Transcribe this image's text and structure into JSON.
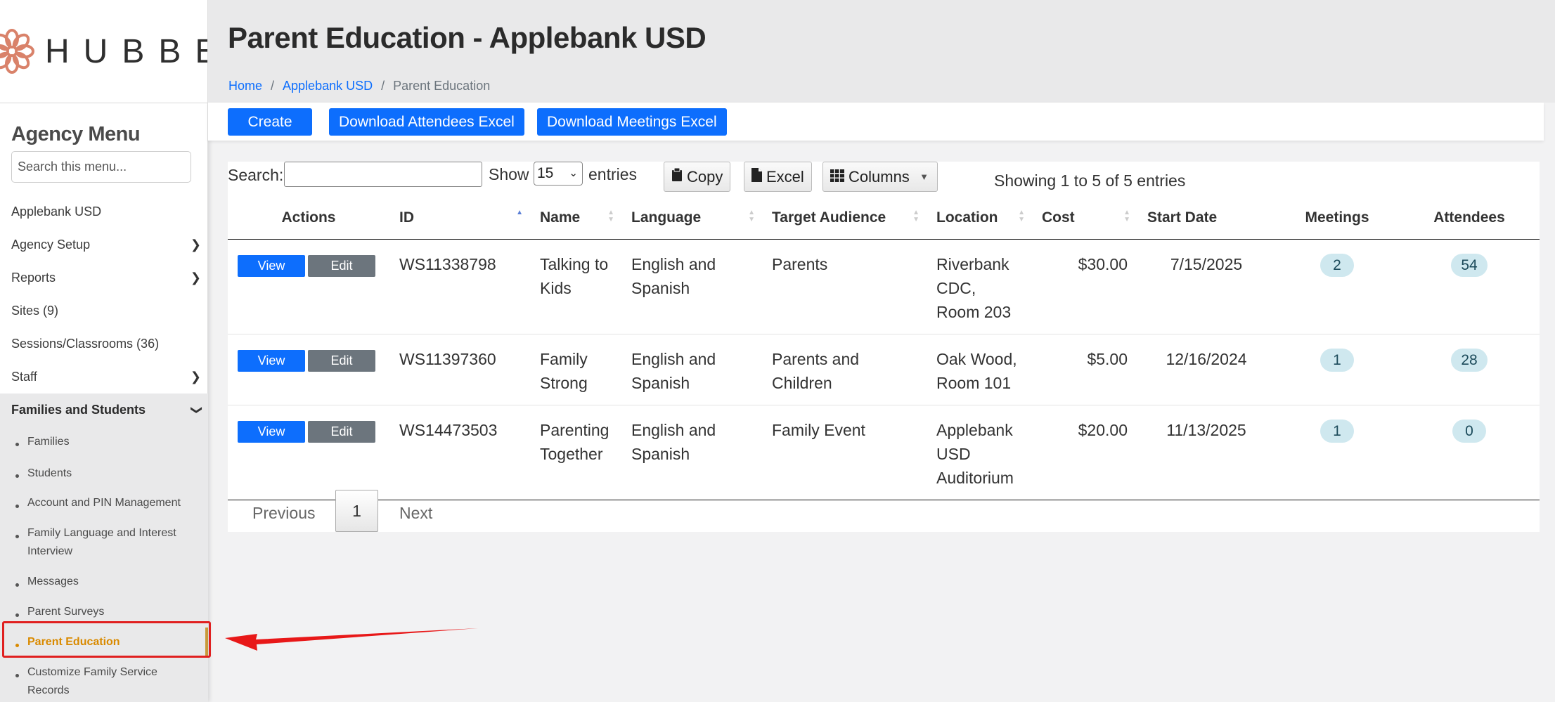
{
  "brand": {
    "name": "HUBBE"
  },
  "sidebar": {
    "title": "Agency Menu",
    "search_placeholder": "Search this menu...",
    "items": [
      {
        "label": "Applebank USD",
        "has_chevron": false
      },
      {
        "label": "Agency Setup",
        "has_chevron": true
      },
      {
        "label": "Reports",
        "has_chevron": true
      },
      {
        "label": "Sites (9)",
        "has_chevron": false
      },
      {
        "label": "Sessions/Classrooms (36)",
        "has_chevron": false
      },
      {
        "label": "Staff",
        "has_chevron": true
      },
      {
        "label": "Families and Students",
        "has_chevron": true,
        "expanded": true
      }
    ],
    "subitems": [
      "Families",
      "Students",
      "Account and PIN Management",
      "Family Language and Interest Interview",
      "Messages",
      "Parent Surveys",
      "Parent Education",
      "Customize Family Service Records"
    ],
    "current_subitem": "Parent Education"
  },
  "header": {
    "title": "Parent Education - Applebank USD",
    "breadcrumb": [
      "Home",
      "Applebank USD",
      "Parent Education"
    ],
    "separator": "/"
  },
  "toolbar": {
    "create_label": "Create",
    "download_attendees_label": "Download Attendees Excel",
    "download_meetings_label": "Download Meetings Excel"
  },
  "table_controls": {
    "search_label": "Search:",
    "search_value": "",
    "show_label": "Show",
    "page_size": "15",
    "entries_label": "entries",
    "copy_label": "Copy",
    "excel_label": "Excel",
    "columns_label": "Columns",
    "info": "Showing 1 to 5 of 5 entries"
  },
  "table": {
    "columns": [
      "Actions",
      "ID",
      "Name",
      "Language",
      "Target Audience",
      "Location",
      "Cost",
      "Start Date",
      "Meetings",
      "Attendees"
    ],
    "view_label": "View",
    "edit_label": "Edit",
    "rows": [
      {
        "id": "WS11338798",
        "name": "Talking to Kids",
        "language": "English and Spanish",
        "audience": "Parents",
        "location": "Riverbank CDC, Room 203",
        "cost": "$30.00",
        "start_date": "7/15/2025",
        "meetings": "2",
        "attendees": "54"
      },
      {
        "id": "WS11397360",
        "name": "Family Strong",
        "language": "English and Spanish",
        "audience": "Parents and Children",
        "location": "Oak Wood, Room 101",
        "cost": "$5.00",
        "start_date": "12/16/2024",
        "meetings": "1",
        "attendees": "28"
      },
      {
        "id": "WS14473503",
        "name": "Parenting Together",
        "language": "English and Spanish",
        "audience": "Family Event",
        "location": "Applebank USD Auditorium",
        "cost": "$20.00",
        "start_date": "11/13/2025",
        "meetings": "1",
        "attendees": "0"
      }
    ]
  },
  "pagination": {
    "previous_label": "Previous",
    "current_page": "1",
    "next_label": "Next"
  },
  "colors": {
    "primary": "#0d6efd",
    "secondary": "#6c757d",
    "active_menu": "#d98a00",
    "highlight": "#e02020",
    "badge_bg": "#cfe8ef"
  }
}
